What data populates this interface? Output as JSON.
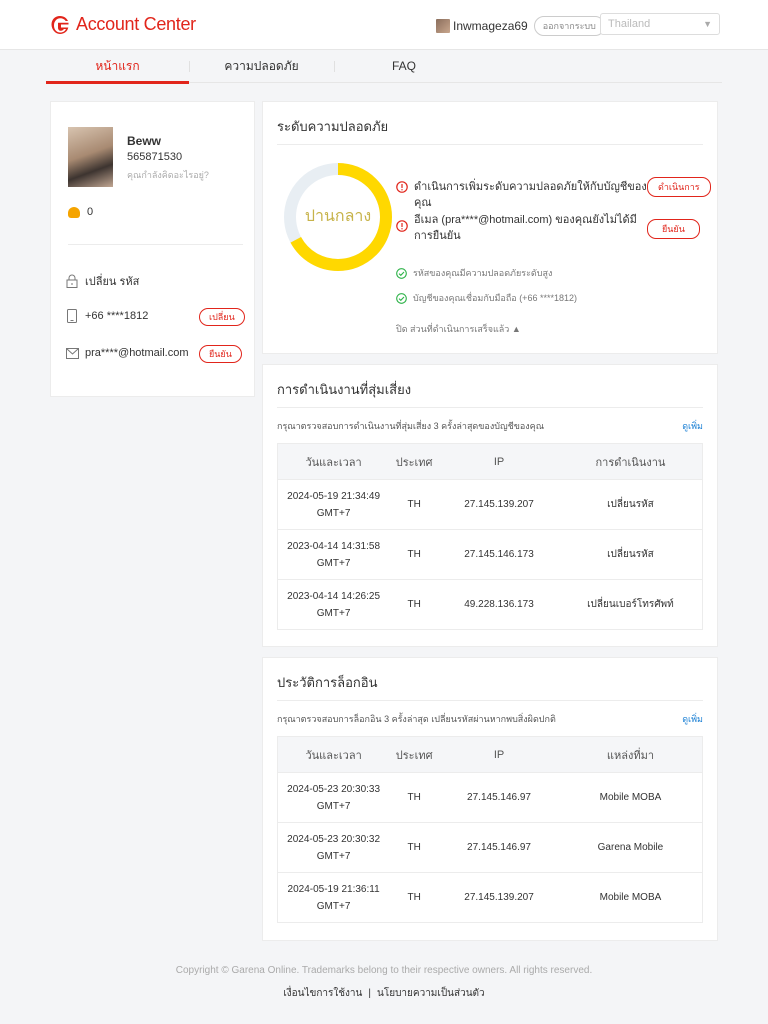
{
  "header": {
    "app_title": "Account Center",
    "username": "Inwmageza69",
    "logout_label": "ออกจากระบบ",
    "region": "Thailand"
  },
  "tabs": [
    {
      "label": "หน้าแรก",
      "active": true
    },
    {
      "label": "ความปลอดภัย",
      "active": false
    },
    {
      "label": "FAQ",
      "active": false
    }
  ],
  "profile": {
    "name": "Beww",
    "id": "565871530",
    "status_prompt": "คุณกำลังคิดอะไรอยู่?",
    "shells": "0",
    "change_password_label": "เปลี่ยน รหัส",
    "phone": "+66 ****1812",
    "phone_action": "เปลี่ยน",
    "email": "pra****@hotmail.com",
    "email_action": "ยืนยัน"
  },
  "security": {
    "title": "ระดับความปลอดภัย",
    "level_label": "ปานกลาง",
    "level_fraction": 0.67,
    "warnings": [
      {
        "text": "ดำเนินการเพิ่มระดับความปลอดภัยให้กับบัญชีของคุณ",
        "action": "ดำเนินการ"
      },
      {
        "text": "อีเมล (pra****@hotmail.com) ของคุณยังไม่ได้มีการยืนยัน",
        "action": "ยืนยัน"
      }
    ],
    "completed": [
      "รหัสของคุณมีความปลอดภัยระดับสูง",
      "บัญชีของคุณเชื่อมกับมือถือ (+66 ****1812)"
    ],
    "collapse_label": "ปิด ส่วนที่ดำเนินการเสร็จแล้ว ▲"
  },
  "risky_ops": {
    "title": "การดำเนินงานที่สุ่มเสี่ยง",
    "subtitle": "กรุณาตรวจสอบการดำเนินงานที่สุ่มเสี่ยง 3 ครั้งล่าสุดของบัญชีของคุณ",
    "more_label": "ดูเพิ่ม",
    "headers": [
      "วันและเวลา",
      "ประเทศ",
      "IP",
      "การดำเนินงาน"
    ],
    "rows": [
      {
        "date": "2024-05-19 21:34:49",
        "tz": "GMT+7",
        "country": "TH",
        "ip": "27.145.139.207",
        "action": "เปลี่ยนรหัส"
      },
      {
        "date": "2023-04-14 14:31:58",
        "tz": "GMT+7",
        "country": "TH",
        "ip": "27.145.146.173",
        "action": "เปลี่ยนรหัส"
      },
      {
        "date": "2023-04-14 14:26:25",
        "tz": "GMT+7",
        "country": "TH",
        "ip": "49.228.136.173",
        "action": "เปลี่ยนเบอร์โทรศัพท์"
      }
    ]
  },
  "login_history": {
    "title": "ประวัติการล็อกอิน",
    "subtitle": "กรุณาตรวจสอบการล็อกอิน 3 ครั้งล่าสุด เปลี่ยนรหัสผ่านหากพบสิ่งผิดปกติ",
    "more_label": "ดูเพิ่ม",
    "headers": [
      "วันและเวลา",
      "ประเทศ",
      "IP",
      "แหล่งที่มา"
    ],
    "rows": [
      {
        "date": "2024-05-23 20:30:33",
        "tz": "GMT+7",
        "country": "TH",
        "ip": "27.145.146.97",
        "source": "Mobile MOBA"
      },
      {
        "date": "2024-05-23 20:30:32",
        "tz": "GMT+7",
        "country": "TH",
        "ip": "27.145.146.97",
        "source": "Garena Mobile"
      },
      {
        "date": "2024-05-19 21:36:11",
        "tz": "GMT+7",
        "country": "TH",
        "ip": "27.145.139.207",
        "source": "Mobile MOBA"
      }
    ]
  },
  "footer": {
    "copyright": "Copyright © Garena Online. Trademarks belong to their respective owners. All rights reserved.",
    "terms_label": "เงื่อนไขการใช้งาน",
    "privacy_label": "นโยบายความเป็นส่วนตัว",
    "separator": "|"
  },
  "colors": {
    "brand_red": "#e1251b",
    "donut_yellow": "#ffd800",
    "donut_track": "#e8eef3",
    "link_blue": "#1a7fd4",
    "ok_green": "#2fb34a"
  }
}
